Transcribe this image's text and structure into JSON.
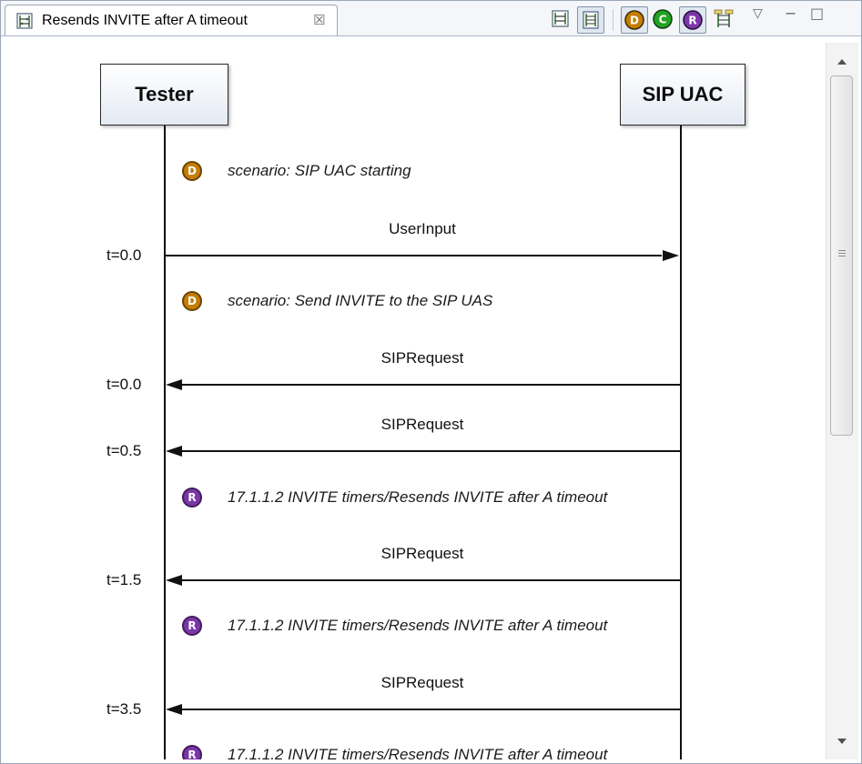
{
  "tab": {
    "title": "Resends INVITE after A timeout",
    "close_glyph": "☒"
  },
  "toolbar": {
    "buttons": [
      {
        "name": "fit-diagram-icon"
      },
      {
        "name": "zoom-toggle-icon",
        "toggled": true
      },
      {
        "name": "filter-debug-icon",
        "letter": "D",
        "color": "#c47e06",
        "toggled": true
      },
      {
        "name": "filter-comment-icon",
        "letter": "C",
        "color": "#23a323",
        "toggled": false
      },
      {
        "name": "filter-result-icon",
        "letter": "R",
        "color": "#7a37a7",
        "toggled": true
      },
      {
        "name": "layout-icon"
      }
    ],
    "view_menu_glyph": "▽",
    "minimize_glyph": "−",
    "maximize_glyph": "□"
  },
  "lifelines": [
    {
      "name": "Tester"
    },
    {
      "name": "SIP UAC"
    }
  ],
  "events": [
    {
      "kind": "note",
      "letter": "D",
      "color": "#c47e06",
      "text": "scenario: SIP UAC starting"
    },
    {
      "kind": "message",
      "label": "UserInput",
      "direction": "right",
      "time": "t=0.0"
    },
    {
      "kind": "note",
      "letter": "D",
      "color": "#c47e06",
      "text": "scenario: Send INVITE to the SIP UAS"
    },
    {
      "kind": "message",
      "label": "SIPRequest",
      "direction": "left",
      "time": "t=0.0"
    },
    {
      "kind": "message",
      "label": "SIPRequest",
      "direction": "left",
      "time": "t=0.5"
    },
    {
      "kind": "note",
      "letter": "R",
      "color": "#7a37a7",
      "text": "17.1.1.2 INVITE timers/Resends INVITE after A timeout"
    },
    {
      "kind": "message",
      "label": "SIPRequest",
      "direction": "left",
      "time": "t=1.5"
    },
    {
      "kind": "note",
      "letter": "R",
      "color": "#7a37a7",
      "text": "17.1.1.2 INVITE timers/Resends INVITE after A timeout"
    },
    {
      "kind": "message",
      "label": "SIPRequest",
      "direction": "left",
      "time": "t=3.5"
    },
    {
      "kind": "note",
      "letter": "R",
      "color": "#7a37a7",
      "text": "17.1.1.2 INVITE timers/Resends INVITE after A timeout"
    }
  ]
}
